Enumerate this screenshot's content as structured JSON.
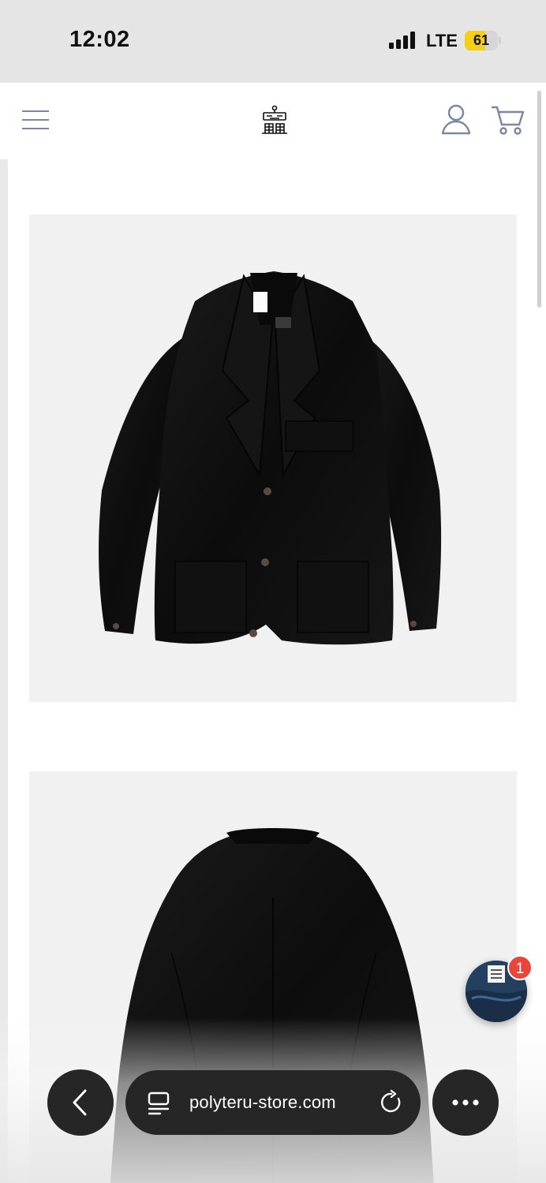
{
  "status_bar": {
    "time": "12:02",
    "network": "LTE",
    "battery": "61",
    "battery_level": 0.61
  },
  "header": {
    "menu_icon": "hamburger-menu-icon",
    "logo": "brand-logo",
    "account_icon": "user-account-icon",
    "cart_icon": "shopping-cart-icon"
  },
  "product": {
    "images": [
      {
        "name": "product-image-front",
        "subject": "black jacket front view"
      },
      {
        "name": "product-image-back",
        "subject": "black jacket back view"
      }
    ]
  },
  "chat": {
    "badge_count": "1"
  },
  "browser": {
    "url": "polyteru-store.com",
    "back_icon": "chevron-left-icon",
    "tabs_icon": "tabs-icon",
    "reload_icon": "reload-icon",
    "more_icon": "more-dots-icon"
  },
  "colors": {
    "nav_icon": "#7b87a0",
    "image_bg": "#f1f1f1",
    "badge": "#e8453c",
    "browser_controls": "#262626",
    "battery_fill": "#f4cf14"
  }
}
